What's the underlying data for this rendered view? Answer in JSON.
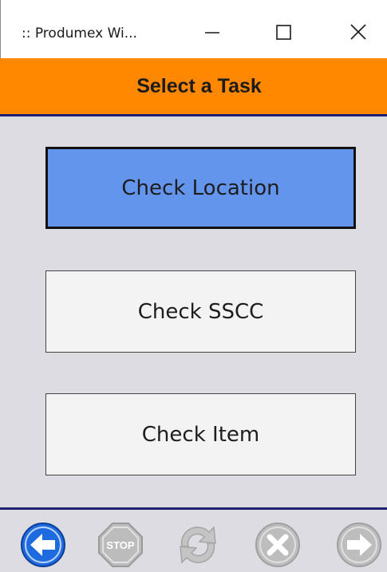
{
  "window": {
    "title": ":: Produmex Wi...",
    "minimize_icon": "minimize-icon",
    "maximize_icon": "maximize-icon",
    "close_icon": "close-icon"
  },
  "header": {
    "title": "Select a Task",
    "background": "#ff8800",
    "border_color": "#1f2070"
  },
  "tasks": [
    {
      "label": "Check Location",
      "selected": true,
      "color": "#6495ed"
    },
    {
      "label": "Check SSCC",
      "selected": false
    },
    {
      "label": "Check Item",
      "selected": false
    }
  ],
  "toolbar": {
    "buttons": [
      {
        "icon": "back-arrow-icon",
        "enabled": true,
        "color": "#1e6be0"
      },
      {
        "icon": "stop-icon",
        "label": "STOP",
        "enabled": false
      },
      {
        "icon": "refresh-icon",
        "enabled": false
      },
      {
        "icon": "cancel-icon",
        "enabled": false
      },
      {
        "icon": "forward-arrow-icon",
        "enabled": false
      }
    ]
  }
}
